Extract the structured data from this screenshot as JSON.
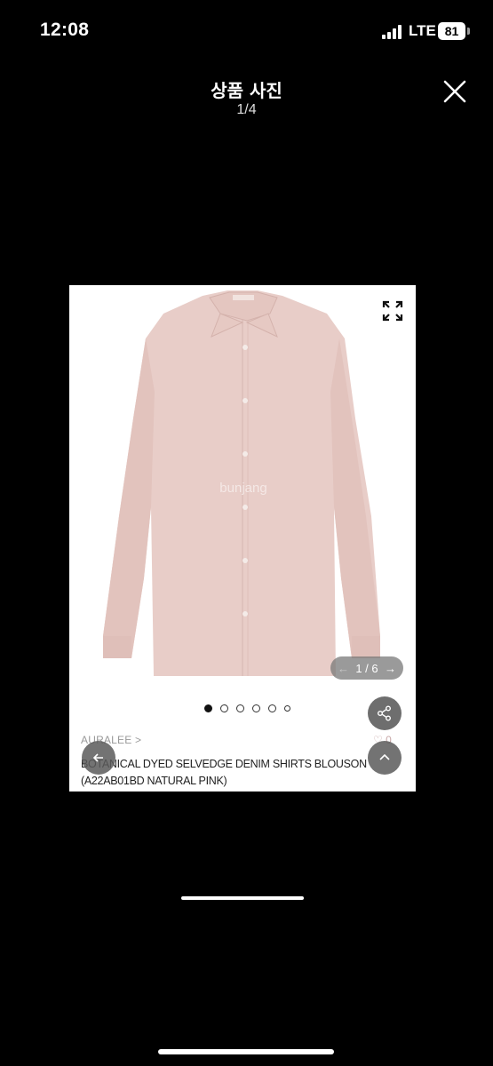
{
  "status": {
    "time": "12:08",
    "network": "LTE",
    "battery": "81"
  },
  "viewer": {
    "title": "상품 사진",
    "counter": "1/4"
  },
  "photo": {
    "watermark": "bunjang",
    "label_text": "AURALEE",
    "gallery_counter": "1 / 6",
    "gallery_prev_arrow": "←",
    "gallery_next_arrow": "→",
    "dots_total": 6,
    "dots_active_index": 0,
    "brand": "AURALEE >",
    "like_count": "♡ 0",
    "product_name": "BOTANICAL DYED SELVEDGE DENIM SHIRTS BLOUSON (A22AB01BD NATURAL PINK)"
  },
  "colors": {
    "shirt": "#e8cdc8",
    "shirt_shadow": "#d9b9b3",
    "background": "#000000"
  }
}
